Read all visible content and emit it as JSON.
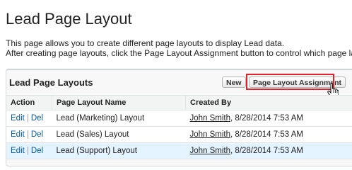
{
  "page": {
    "title": "Lead Page Layout",
    "description_line1": "This page allows you to create different page layouts to display Lead data.",
    "description_line2": "After creating page layouts, click the Page Layout Assignment button to control which page lay"
  },
  "panel": {
    "title": "Lead Page Layouts",
    "new_button": "New",
    "assign_button": "Page Layout Assignment",
    "highlight_color": "#e0242a"
  },
  "table": {
    "headers": [
      "Action",
      "Page Layout Name",
      "Created By"
    ],
    "rows": [
      {
        "edit": "Edit",
        "sep": "|",
        "del": "Del",
        "name": "Lead (Marketing) Layout",
        "user": "John Smith",
        "date": ", 8/28/2014 7:53 AM"
      },
      {
        "edit": "Edit",
        "sep": "|",
        "del": "Del",
        "name": "Lead (Sales) Layout",
        "user": "John Smith",
        "date": ", 8/28/2014 7:53 AM"
      },
      {
        "edit": "Edit",
        "sep": "|",
        "del": "Del",
        "name": "Lead (Support) Layout",
        "user": "John Smith",
        "date": ", 8/28/2014 7:53 AM"
      }
    ]
  }
}
